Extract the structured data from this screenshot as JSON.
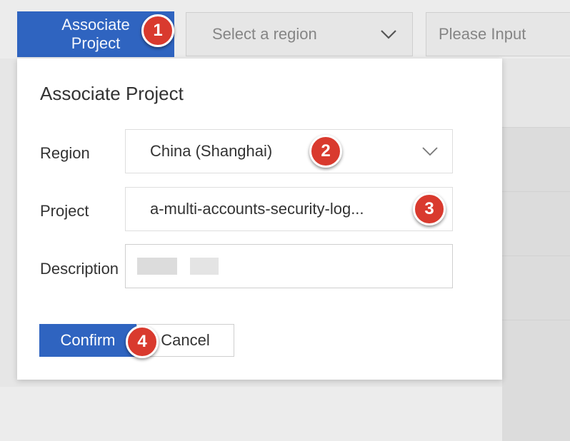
{
  "toolbar": {
    "associate_label": "Associate Project",
    "region_placeholder": "Select a region",
    "search_placeholder": "Please Input"
  },
  "dialog": {
    "title": "Associate Project",
    "region_label": "Region",
    "region_value": "China (Shanghai)",
    "project_label": "Project",
    "project_value": "a-multi-accounts-security-log...",
    "description_label": "Description",
    "confirm_label": "Confirm",
    "cancel_label": "Cancel"
  },
  "markers": [
    "1",
    "2",
    "3",
    "4"
  ],
  "colors": {
    "primary": "#2f64c0",
    "marker": "#d93a2e",
    "overlay": "#ececec"
  },
  "icons": {
    "dropdown": "chevron-down-icon"
  }
}
